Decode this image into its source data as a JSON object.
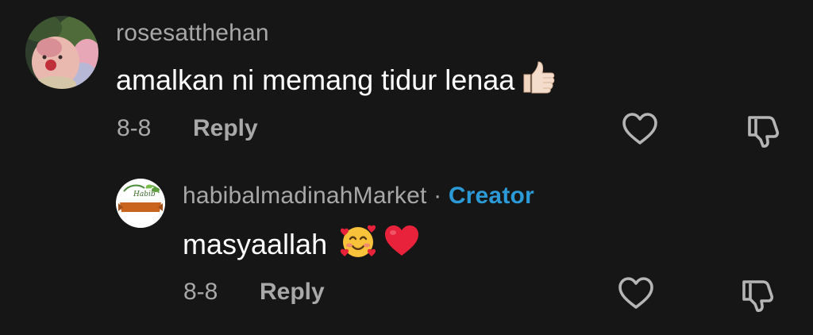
{
  "comments": [
    {
      "username": "rosesatthehan",
      "text": "amalkan ni memang tidur lenaa",
      "emoji": "thumbs-up-light-skin",
      "time": "8-8",
      "reply_label": "Reply",
      "avatar": "avatar-plush-toys"
    }
  ],
  "reply": {
    "username": "habibalmadinahMarket",
    "separator": "·",
    "badge": "Creator",
    "text": "masyaallah",
    "emojis": [
      "smiling-face-with-hearts",
      "red-heart"
    ],
    "time": "8-8",
    "reply_label": "Reply",
    "avatar": "avatar-habib-logo",
    "logo_text": "HABIB YA SALAM"
  },
  "icons": {
    "like": "heart-outline-icon",
    "dislike": "thumbs-down-outline-icon"
  },
  "colors": {
    "background": "#161616",
    "username": "#a8a8a8",
    "text": "#ffffff",
    "creator": "#2b9ad6",
    "heart_red": "#e8223a"
  }
}
